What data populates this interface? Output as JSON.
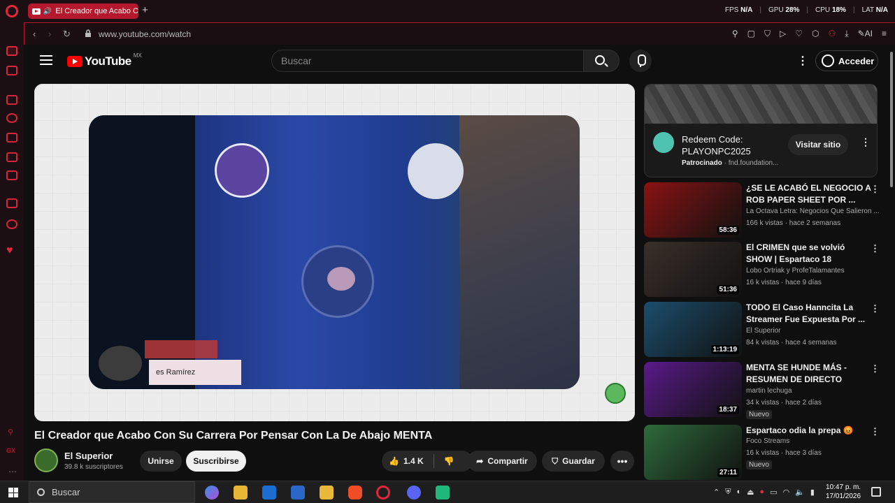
{
  "browser": {
    "tab_title": "El Creador que Acabo C",
    "new_tab": "+",
    "stats": {
      "fps_label": "FPS",
      "fps_value": "N/A",
      "gpu_label": "GPU",
      "gpu_value": "28%",
      "cpu_label": "CPU",
      "cpu_value": "18%",
      "lat_label": "LAT",
      "lat_value": "N/A"
    },
    "url": "www.youtube.com/watch",
    "ai_label": "AI"
  },
  "youtube": {
    "logo_text": "YouTube",
    "country_code": "MX",
    "search_placeholder": "Buscar",
    "signin_label": "Acceder",
    "video": {
      "chat_text": "es Ramírez",
      "title": "El Creador que Acabo Con Su Carrera Por Pensar Con La De Abajo MENTA",
      "channel": "El Superior",
      "subscribers": "39.8 k suscriptores",
      "join_label": "Unirse",
      "subscribe_label": "Suscribirse",
      "likes": "1.4 K",
      "share_label": "Compartir",
      "save_label": "Guardar"
    },
    "ad": {
      "title": "Redeem Code: PLAYONPC2025",
      "sponsored_label": "Patrocinado",
      "domain": "fnd.foundation...",
      "cta": "Visitar sitio"
    },
    "recommendations": [
      {
        "title": "¿SE LE ACABÓ EL NEGOCIO A ROB PAPER SHEET POR ...",
        "channel": "La Octava Letra: Negocios Que Salieron ...",
        "meta": "166 k vistas · hace 2 semanas",
        "duration": "58:36",
        "color": "#8a1212",
        "badge": ""
      },
      {
        "title": "El CRIMEN que se volvió SHOW | Espartaco 18",
        "channel": "Lobo Ortriak y ProfeTalamantes",
        "meta": "16 k vistas · hace 9 días",
        "duration": "51:36",
        "color": "#3a2f2a",
        "badge": ""
      },
      {
        "title": "TODO El Caso Hanncita La Streamer Fue Expuesta Por ...",
        "channel": "El Superior",
        "meta": "84 k vistas · hace 4 semanas",
        "duration": "1:13:19",
        "color": "#1c4e6e",
        "badge": ""
      },
      {
        "title": "MENTA SE HUNDE MÁS - RESUMEN DE DIRECTO",
        "channel": "martin lechuga",
        "meta": "34 k vistas · hace 2 días",
        "duration": "18:37",
        "color": "#5a1a8a",
        "badge": "Nuevo"
      },
      {
        "title": "Espartaco odia la prepa 😡",
        "channel": "Foco Streams",
        "meta": "16 k vistas · hace 3 días",
        "duration": "27:11",
        "color": "#2e6b3b",
        "badge": "Nuevo"
      }
    ]
  },
  "taskbar": {
    "search_label": "Buscar",
    "time": "10:47 p. m.",
    "date": "17/01/2026"
  }
}
